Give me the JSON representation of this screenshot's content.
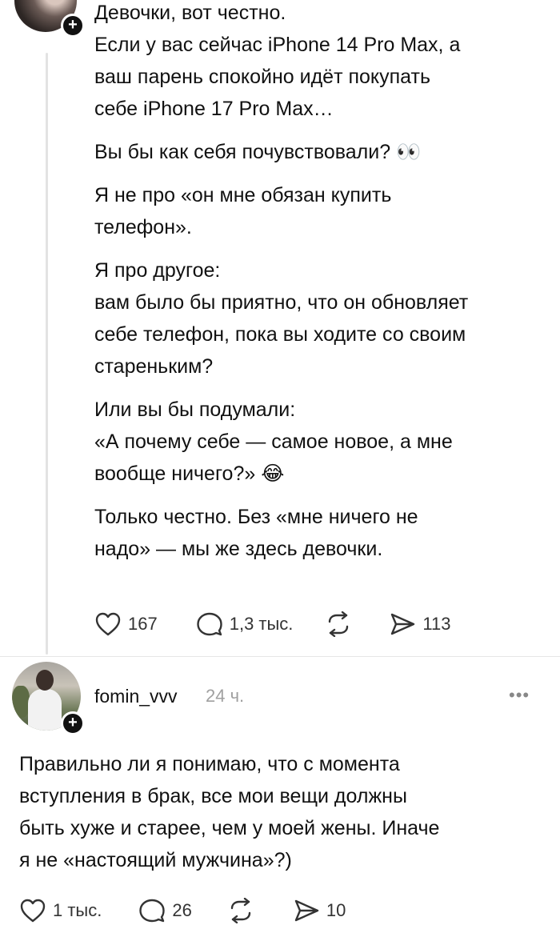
{
  "post": {
    "paragraphs": [
      [
        "Девочки, вот честно.",
        "Если у вас сейчас iPhone 14 Pro Max, а",
        "ваш парень спокойно идёт покупать",
        "себе iPhone 17 Pro Max…"
      ],
      [
        "Вы бы как себя почувствовали? 👀"
      ],
      [
        "Я не про «он мне обязан купить",
        "телефон»."
      ],
      [
        "Я про другое:",
        "вам было бы приятно, что он обновляет",
        "себе телефон, пока вы ходите со своим",
        "стареньким?"
      ],
      [
        "Или вы бы подумали:",
        "«А почему себе — самое новое, а мне",
        "вообще ничего?» 😂"
      ],
      [
        "Только честно. Без «мне ничего не",
        "надо» — мы же здесь девочки."
      ]
    ],
    "likes": "167",
    "replies": "1,3 тыс.",
    "shares": "113"
  },
  "comment": {
    "username": "fomin_vvv",
    "time": "24 ч.",
    "more": "•••",
    "lines": [
      "Правильно ли я понимаю, что с момента",
      "вступления в брак, все мои вещи должны",
      "быть хуже и старее, чем у моей жены. Иначе",
      "я не «настоящий мужчина»?)"
    ],
    "likes": "1 тыс.",
    "replies": "26",
    "shares": "10"
  },
  "colors": {
    "text": "#111111",
    "muted": "#a0a0a0",
    "divider": "#e6e6e6"
  },
  "icons": [
    "plus-icon",
    "heart-icon",
    "comment-icon",
    "repost-icon",
    "send-icon",
    "more-icon"
  ]
}
